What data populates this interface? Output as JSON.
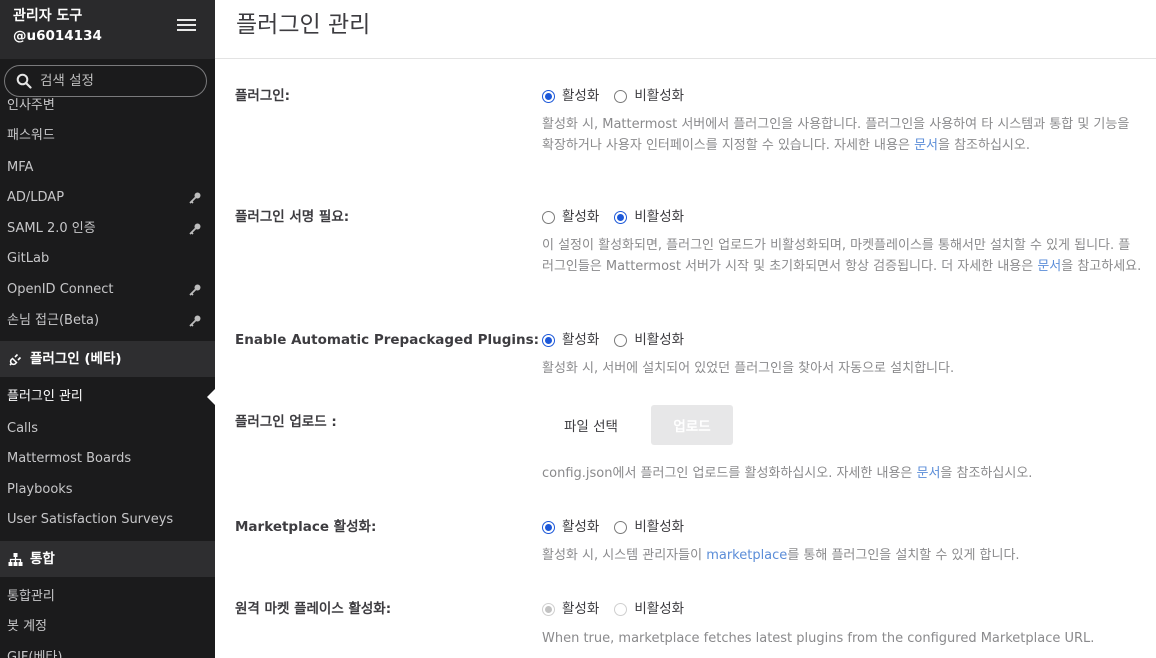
{
  "sidebar": {
    "title": "관리자 도구",
    "username": "@u6014134",
    "search_placeholder": "검색 설정",
    "items": {
      "partial": "인사주변",
      "password": "패스워드",
      "mfa": "MFA",
      "adldap": "AD/LDAP",
      "saml": "SAML 2.0 인증",
      "gitlab": "GitLab",
      "openid": "OpenID Connect",
      "guest": "손님 접근(Beta)",
      "plugin_manage": "플러그인 관리",
      "calls": "Calls",
      "boards": "Mattermost Boards",
      "playbooks": "Playbooks",
      "surveys": "User Satisfaction Surveys",
      "integration_manage": "통합관리",
      "bot_accounts": "봇 계정",
      "gif": "GIF(베타)"
    },
    "sections": {
      "plugins": "플러그인 (베타)",
      "integrations": "통합"
    }
  },
  "page": {
    "title": "플러그인 관리"
  },
  "settings": {
    "plugins": {
      "label": "플러그인:",
      "opt_on": "활성화",
      "opt_off": "비활성화",
      "help_pre": "활성화 시, Mattermost 서버에서 플러그인을 사용합니다. 플러그인을 사용하여 타 시스템과 통합 및 기능을 확장하거나 사용자 인터페이스를 지정할 수 있습니다. 자세한 내용은 ",
      "help_link": "문서",
      "help_post": "을 참조하십시오."
    },
    "signature": {
      "label": "플러그인 서명 필요:",
      "opt_on": "활성화",
      "opt_off": "비활성화",
      "help_pre": "이 설정이 활성화되면, 플러그인 업로드가 비활성화되며, 마켓플레이스를 통해서만 설치할 수 있게 됩니다. 플러그인들은 Mattermost 서버가 시작 및 초기화되면서 항상 검증됩니다. 더 자세한 내용은 ",
      "help_link": "문서",
      "help_post": "을 참고하세요."
    },
    "prepackaged": {
      "label": "Enable Automatic Prepackaged Plugins:",
      "opt_on": "활성화",
      "opt_off": "비활성화",
      "help": "활성화 시, 서버에 설치되어 있었던 플러그인을 찾아서 자동으로 설치합니다."
    },
    "upload": {
      "label": "플러그인 업로드 :",
      "file_button": "파일 선택",
      "upload_button": "업로드",
      "help_pre": "config.json에서 플러그인 업로드를 활성화하십시오. 자세한 내용은 ",
      "help_link": "문서",
      "help_post": "을 참조하십시오."
    },
    "marketplace": {
      "label": "Marketplace 활성화:",
      "opt_on": "활성화",
      "opt_off": "비활성화",
      "help_pre": "활성화 시, 시스템 관리자들이 ",
      "help_link": "marketplace",
      "help_post": "를 통해 플러그인을 설치할 수 있게 합니다."
    },
    "remote_marketplace": {
      "label": "원격 마켓 플레이스 활성화:",
      "opt_on": "활성화",
      "opt_off": "비활성화",
      "help": "When true, marketplace fetches latest plugins from the configured Marketplace URL."
    }
  },
  "colors": {
    "sidebar_bg": "#1b1b1c",
    "sidebar_header_bg": "#2a2a2c",
    "section_bg": "#2e2e30",
    "radio_accent": "#1c58d9",
    "link": "#5b8dd8"
  }
}
